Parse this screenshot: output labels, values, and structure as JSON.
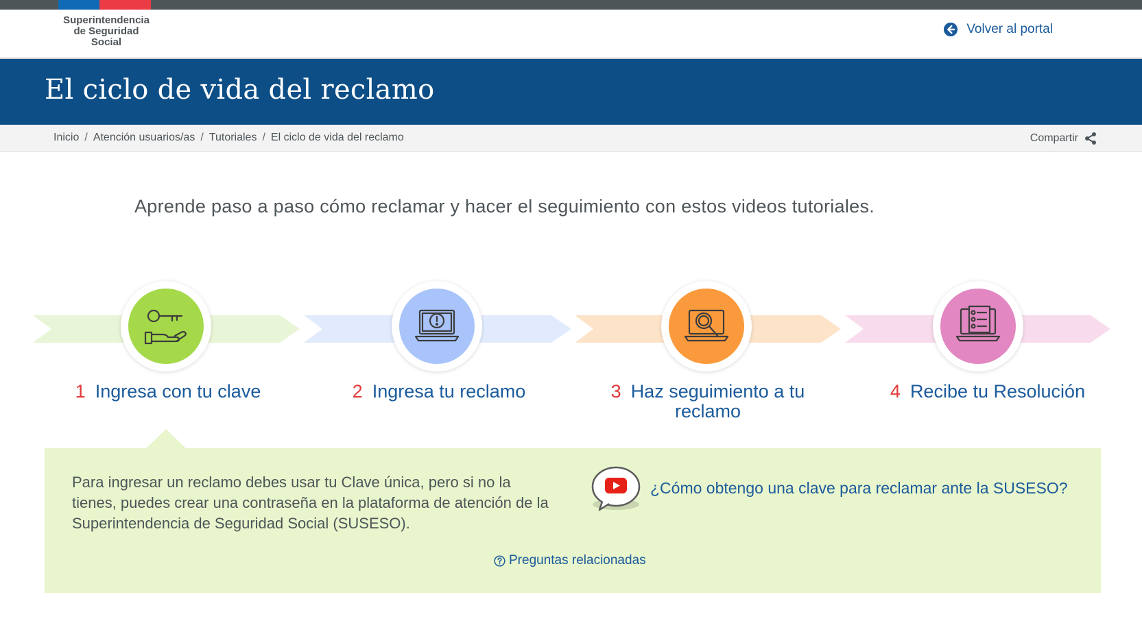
{
  "header": {
    "logo_lines": [
      "Superintendencia",
      "de Seguridad",
      "Social"
    ],
    "back_label": "Volver al portal"
  },
  "banner": {
    "title": "El ciclo de vida del reclamo"
  },
  "breadcrumb": {
    "items": [
      "Inicio",
      "Atención usuarios/as",
      "Tutoriales",
      "El ciclo de vida del reclamo"
    ],
    "separator": "/"
  },
  "share_label": "Compartir",
  "intro": "Aprende paso a paso cómo reclamar y hacer el seguimiento con estos videos tutoriales.",
  "steps": [
    {
      "number": "1",
      "label": "Ingresa con tu clave",
      "icon": "key-hand-icon",
      "color": "#a5d94a",
      "arrow_color": "#e8f5d6"
    },
    {
      "number": "2",
      "label": "Ingresa tu reclamo",
      "icon": "laptop-alert-icon",
      "color": "#a8c4fa",
      "arrow_color": "#e1ebfd"
    },
    {
      "number": "3",
      "label": "Haz seguimiento a tu reclamo",
      "icon": "laptop-search-icon",
      "color": "#fb9a3c",
      "arrow_color": "#fde3c8"
    },
    {
      "number": "4",
      "label": "Recibe tu Resolución",
      "icon": "document-checklist-icon",
      "color": "#e287c1",
      "arrow_color": "#f8dced"
    }
  ],
  "panel": {
    "text": "Para ingresar un reclamo debes usar tu Clave única, pero si no la tienes, puedes crear una contraseña en la plataforma de atención de la Superintendencia de Seguridad Social (SUSESO).",
    "video_link": "¿Cómo obtengo una clave para reclamar ante la SUSESO?",
    "faq_link": "Preguntas relacionadas"
  },
  "colors": {
    "banner": "#0d4e86",
    "link": "#1b5b9c",
    "step_number": "#e23a3a",
    "panel_bg": "#e9f5cc"
  }
}
